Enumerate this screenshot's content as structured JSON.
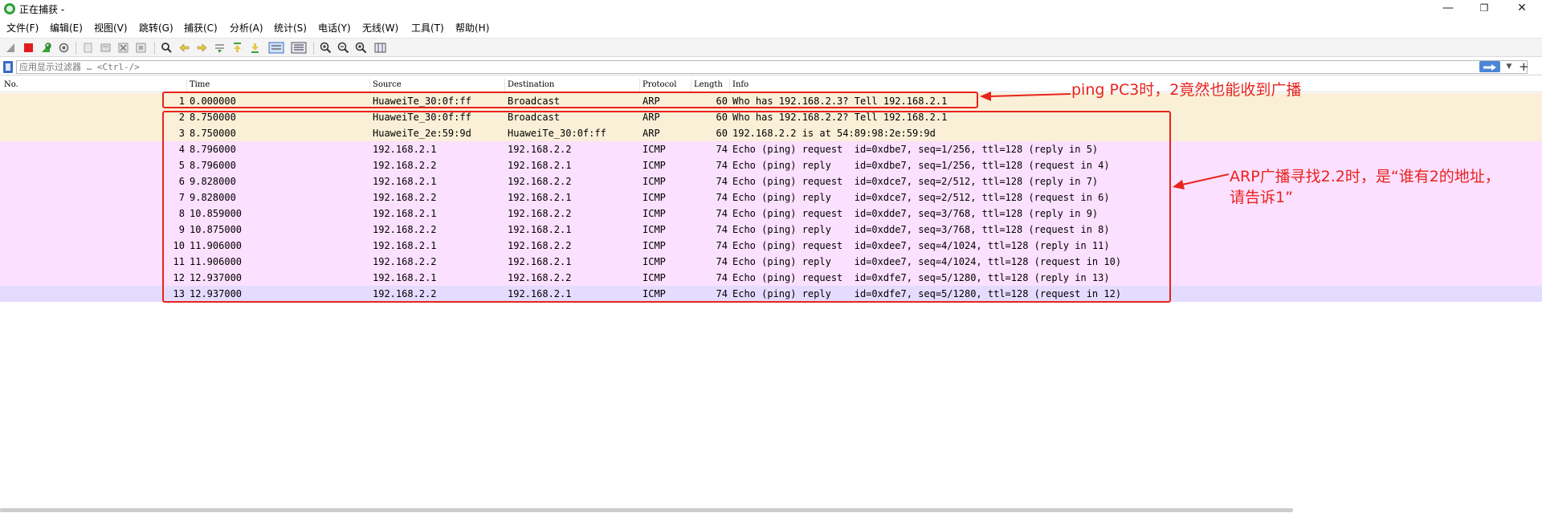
{
  "window": {
    "title": "正在捕获 -",
    "minimize": "—",
    "restore": "❐",
    "close": "✕"
  },
  "menu": [
    "文件(F)",
    "编辑(E)",
    "视图(V)",
    "跳转(G)",
    "捕获(C)",
    "分析(A)",
    "统计(S)",
    "电话(Y)",
    "无线(W)",
    "工具(T)",
    "帮助(H)"
  ],
  "filter": {
    "placeholder": "应用显示过滤器 … <Ctrl-/>",
    "plus": "+"
  },
  "columns": {
    "no": "No.",
    "time": "Time",
    "source": "Source",
    "destination": "Destination",
    "protocol": "Protocol",
    "length": "Length",
    "info": "Info"
  },
  "packets": [
    {
      "no": "1",
      "time": "0.000000",
      "source": "HuaweiTe_30:0f:ff",
      "destination": "Broadcast",
      "protocol": "ARP",
      "length": "60",
      "info": "Who has 192.168.2.3? Tell 192.168.2.1",
      "color": "#faf0d7"
    },
    {
      "no": "2",
      "time": "8.750000",
      "source": "HuaweiTe_30:0f:ff",
      "destination": "Broadcast",
      "protocol": "ARP",
      "length": "60",
      "info": "Who has 192.168.2.2? Tell 192.168.2.1",
      "color": "#faf0d7"
    },
    {
      "no": "3",
      "time": "8.750000",
      "source": "HuaweiTe_2e:59:9d",
      "destination": "HuaweiTe_30:0f:ff",
      "protocol": "ARP",
      "length": "60",
      "info": "192.168.2.2 is at 54:89:98:2e:59:9d",
      "color": "#faf0d7"
    },
    {
      "no": "4",
      "time": "8.796000",
      "source": "192.168.2.1",
      "destination": "192.168.2.2",
      "protocol": "ICMP",
      "length": "74",
      "info": "Echo (ping) request  id=0xdbe7, seq=1/256, ttl=128 (reply in 5)",
      "color": "#fce0ff"
    },
    {
      "no": "5",
      "time": "8.796000",
      "source": "192.168.2.2",
      "destination": "192.168.2.1",
      "protocol": "ICMP",
      "length": "74",
      "info": "Echo (ping) reply    id=0xdbe7, seq=1/256, ttl=128 (request in 4)",
      "color": "#fce0ff"
    },
    {
      "no": "6",
      "time": "9.828000",
      "source": "192.168.2.1",
      "destination": "192.168.2.2",
      "protocol": "ICMP",
      "length": "74",
      "info": "Echo (ping) request  id=0xdce7, seq=2/512, ttl=128 (reply in 7)",
      "color": "#fce0ff"
    },
    {
      "no": "7",
      "time": "9.828000",
      "source": "192.168.2.2",
      "destination": "192.168.2.1",
      "protocol": "ICMP",
      "length": "74",
      "info": "Echo (ping) reply    id=0xdce7, seq=2/512, ttl=128 (request in 6)",
      "color": "#fce0ff"
    },
    {
      "no": "8",
      "time": "10.859000",
      "source": "192.168.2.1",
      "destination": "192.168.2.2",
      "protocol": "ICMP",
      "length": "74",
      "info": "Echo (ping) request  id=0xdde7, seq=3/768, ttl=128 (reply in 9)",
      "color": "#fce0ff"
    },
    {
      "no": "9",
      "time": "10.875000",
      "source": "192.168.2.2",
      "destination": "192.168.2.1",
      "protocol": "ICMP",
      "length": "74",
      "info": "Echo (ping) reply    id=0xdde7, seq=3/768, ttl=128 (request in 8)",
      "color": "#fce0ff"
    },
    {
      "no": "10",
      "time": "11.906000",
      "source": "192.168.2.1",
      "destination": "192.168.2.2",
      "protocol": "ICMP",
      "length": "74",
      "info": "Echo (ping) request  id=0xdee7, seq=4/1024, ttl=128 (reply in 11)",
      "color": "#fce0ff"
    },
    {
      "no": "11",
      "time": "11.906000",
      "source": "192.168.2.2",
      "destination": "192.168.2.1",
      "protocol": "ICMP",
      "length": "74",
      "info": "Echo (ping) reply    id=0xdee7, seq=4/1024, ttl=128 (request in 10)",
      "color": "#fce0ff"
    },
    {
      "no": "12",
      "time": "12.937000",
      "source": "192.168.2.1",
      "destination": "192.168.2.2",
      "protocol": "ICMP",
      "length": "74",
      "info": "Echo (ping) request  id=0xdfe7, seq=5/1280, ttl=128 (reply in 13)",
      "color": "#fce0ff"
    },
    {
      "no": "13",
      "time": "12.937000",
      "source": "192.168.2.2",
      "destination": "192.168.2.1",
      "protocol": "ICMP",
      "length": "74",
      "info": "Echo (ping) reply    id=0xdfe7, seq=5/1280, ttl=128 (request in 12)",
      "color": "#e4dcff"
    }
  ],
  "annotations": {
    "note1": "ping PC3时，2竟然也能收到广播",
    "note2_line1": "ARP广播寻找2.2时，是“谁有2的地址，",
    "note2_line2": "请告诉1”",
    "color": "#e8231e"
  }
}
